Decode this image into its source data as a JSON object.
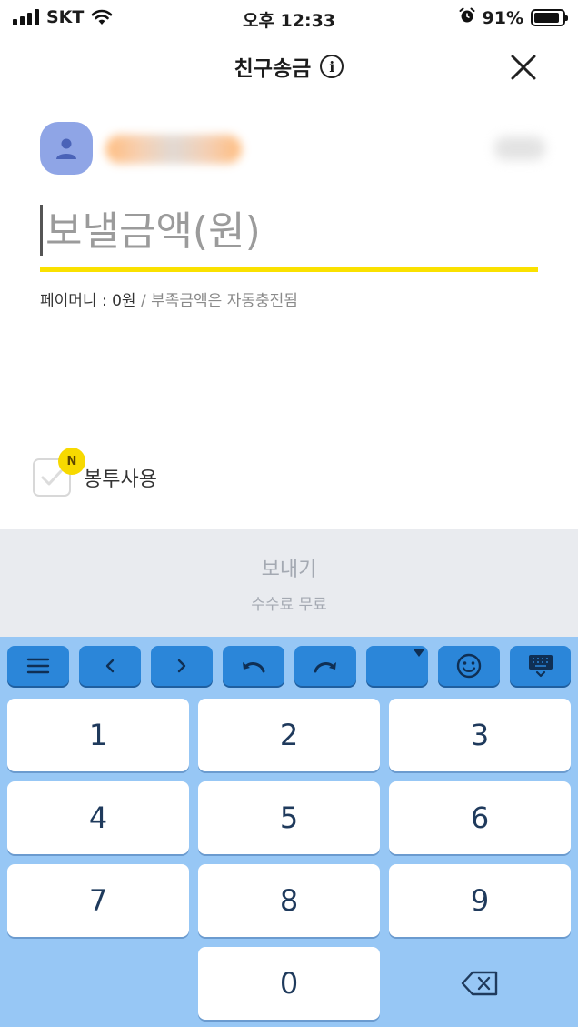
{
  "status_bar": {
    "carrier": "SKT",
    "time": "오후 12:33",
    "battery": "91%",
    "battery_level": 0.91
  },
  "header": {
    "title": "친구송금",
    "info_glyph": "i"
  },
  "amount": {
    "placeholder": "보낼금액(원)"
  },
  "balance": {
    "text": "페이머니 : 0원",
    "note": " / 부족금액은 자동충전됨"
  },
  "envelope": {
    "badge": "N",
    "label": "봉투사용"
  },
  "send": {
    "label": "보내기",
    "fee": "수수료 무료"
  },
  "keyboard": {
    "keys": [
      "1",
      "2",
      "3",
      "4",
      "5",
      "6",
      "7",
      "8",
      "9",
      "0"
    ],
    "toolbar_icons": [
      "menu-icon",
      "chevron-left-icon",
      "chevron-right-icon",
      "undo-icon",
      "redo-icon",
      "blank-dropdown",
      "emoji-icon",
      "keyboard-hide-icon"
    ]
  },
  "colors": {
    "accent_yellow": "#fae100",
    "avatar": "#8fa5e6",
    "keyboard_bg": "#97c7f5",
    "toolbar_key": "#2b86d9"
  }
}
